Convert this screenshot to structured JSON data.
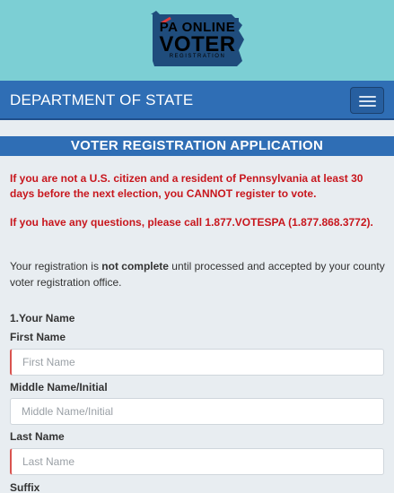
{
  "brand": {
    "line1": "PA ONLINE",
    "line2": "VOTER",
    "line3": "REGISTRATION",
    "colors": {
      "banner": "#7ccfd4",
      "logo_bg": "#1f4c7c",
      "accent": "#e23b3b"
    }
  },
  "navbar": {
    "title": "DEPARTMENT OF STATE",
    "menu_icon": "hamburger-icon",
    "color": "#2f6eb5"
  },
  "form": {
    "header": "VOTER REGISTRATION APPLICATION",
    "warning1": "If you are not a U.S. citizen and a resident of Pennsylvania at least 30 days before the next election, you CANNOT register to vote.",
    "warning2": "If you have any questions, please call 1.877.VOTESPA (1.877.868.3772).",
    "info_prefix": "Your registration is ",
    "info_bold": "not complete",
    "info_suffix": " until processed and accepted by your county voter registration office.",
    "section_label": "1.Your Name",
    "first_name": {
      "label": "First Name",
      "placeholder": "First Name",
      "value": ""
    },
    "middle_name": {
      "label": "Middle Name/Initial",
      "placeholder": "Middle Name/Initial",
      "value": ""
    },
    "last_name": {
      "label": "Last Name",
      "placeholder": "Last Name",
      "value": ""
    },
    "suffix": {
      "label": "Suffix"
    }
  }
}
